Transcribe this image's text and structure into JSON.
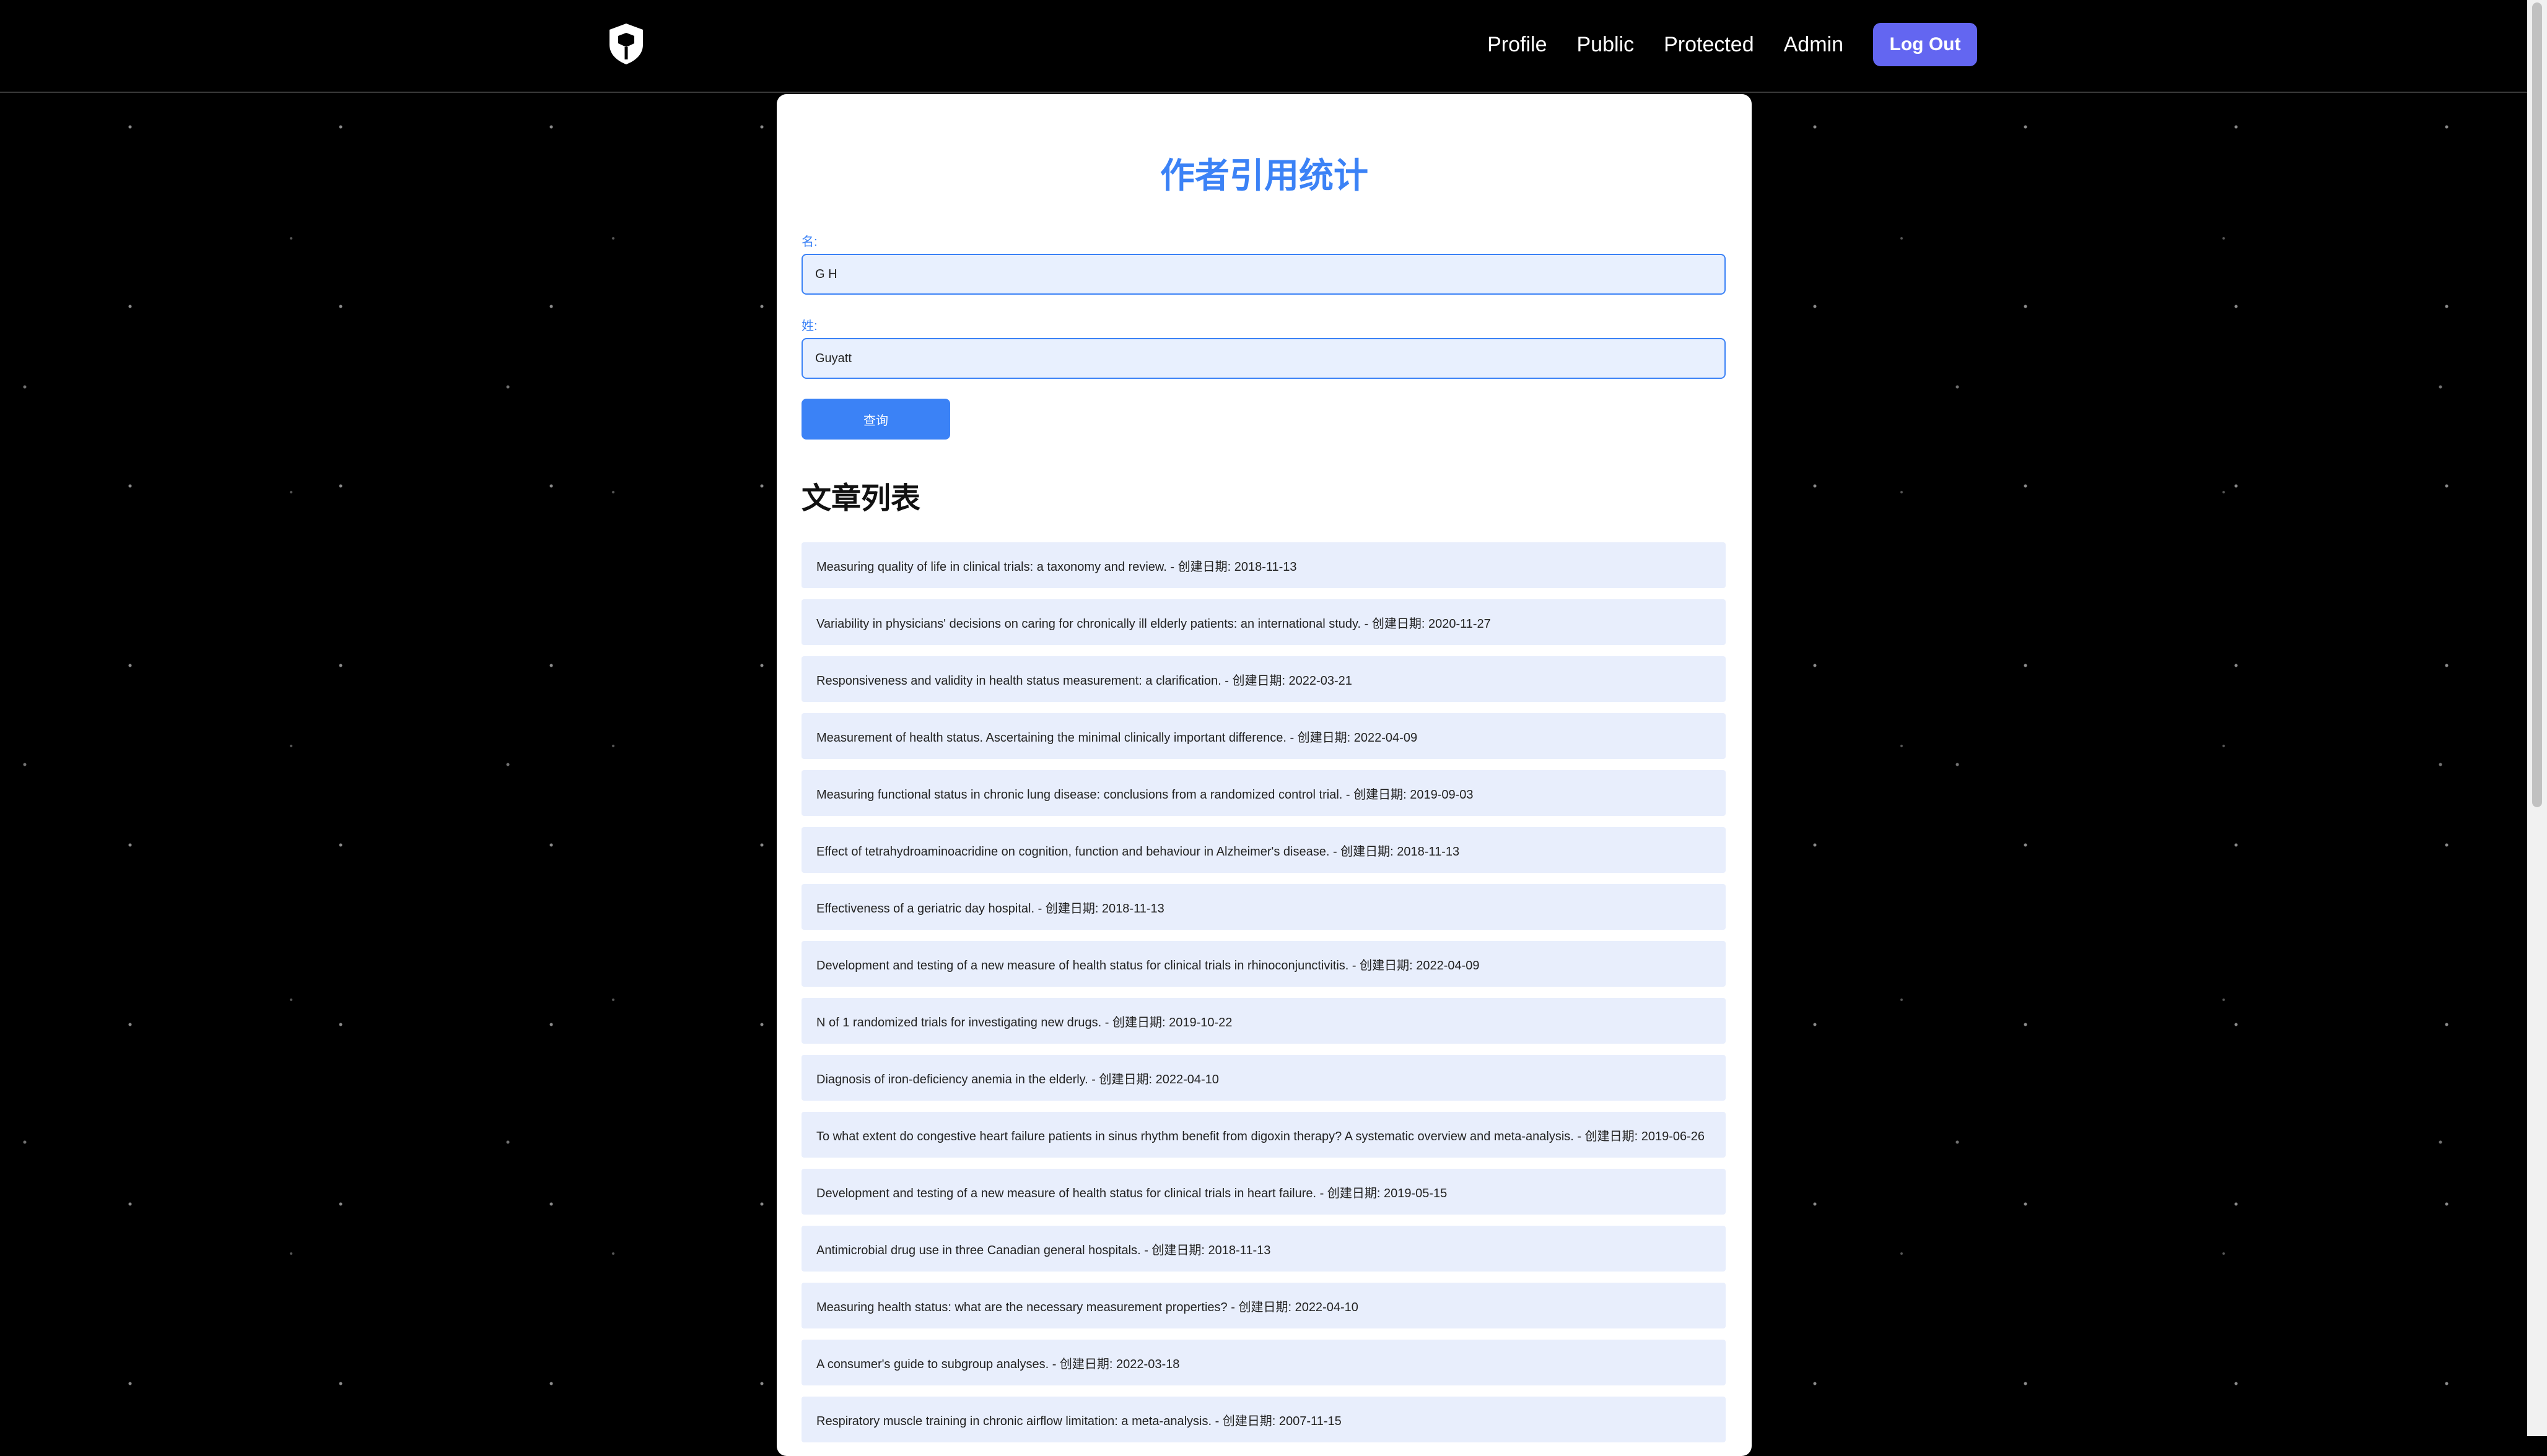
{
  "nav": {
    "logo_icon": "shield-icon",
    "links": [
      "Profile",
      "Public",
      "Protected",
      "Admin"
    ],
    "logout_label": "Log Out"
  },
  "form": {
    "title": "作者引用统计",
    "first_name_label": "名:",
    "first_name_value": "G H",
    "last_name_label": "姓:",
    "last_name_value": "Guyatt",
    "query_label": "查询"
  },
  "articles": {
    "heading": "文章列表",
    "items": [
      "Measuring quality of life in clinical trials: a taxonomy and review. - 创建日期: 2018-11-13",
      "Variability in physicians' decisions on caring for chronically ill elderly patients: an international study. - 创建日期: 2020-11-27",
      "Responsiveness and validity in health status measurement: a clarification. - 创建日期: 2022-03-21",
      "Measurement of health status. Ascertaining the minimal clinically important difference. - 创建日期: 2022-04-09",
      "Measuring functional status in chronic lung disease: conclusions from a randomized control trial. - 创建日期: 2019-09-03",
      "Effect of tetrahydroaminoacridine on cognition, function and behaviour in Alzheimer's disease. - 创建日期: 2018-11-13",
      "Effectiveness of a geriatric day hospital. - 创建日期: 2018-11-13",
      "Development and testing of a new measure of health status for clinical trials in rhinoconjunctivitis. - 创建日期: 2022-04-09",
      "N of 1 randomized trials for investigating new drugs. - 创建日期: 2019-10-22",
      "Diagnosis of iron-deficiency anemia in the elderly. - 创建日期: 2022-04-10",
      "To what extent do congestive heart failure patients in sinus rhythm benefit from digoxin therapy? A systematic overview and meta-analysis. - 创建日期: 2019-06-26",
      "Development and testing of a new measure of health status for clinical trials in heart failure. - 创建日期: 2019-05-15",
      "Antimicrobial drug use in three Canadian general hospitals. - 创建日期: 2018-11-13",
      "Measuring health status: what are the necessary measurement properties? - 创建日期: 2022-04-10",
      "A consumer's guide to subgroup analyses. - 创建日期: 2022-03-18",
      "Respiratory muscle training in chronic airflow limitation: a meta-analysis. - 创建日期: 2007-11-15"
    ]
  },
  "colors": {
    "accent": "#3b82f6",
    "logout": "#6366f1",
    "item_bg": "#e8eefc"
  }
}
